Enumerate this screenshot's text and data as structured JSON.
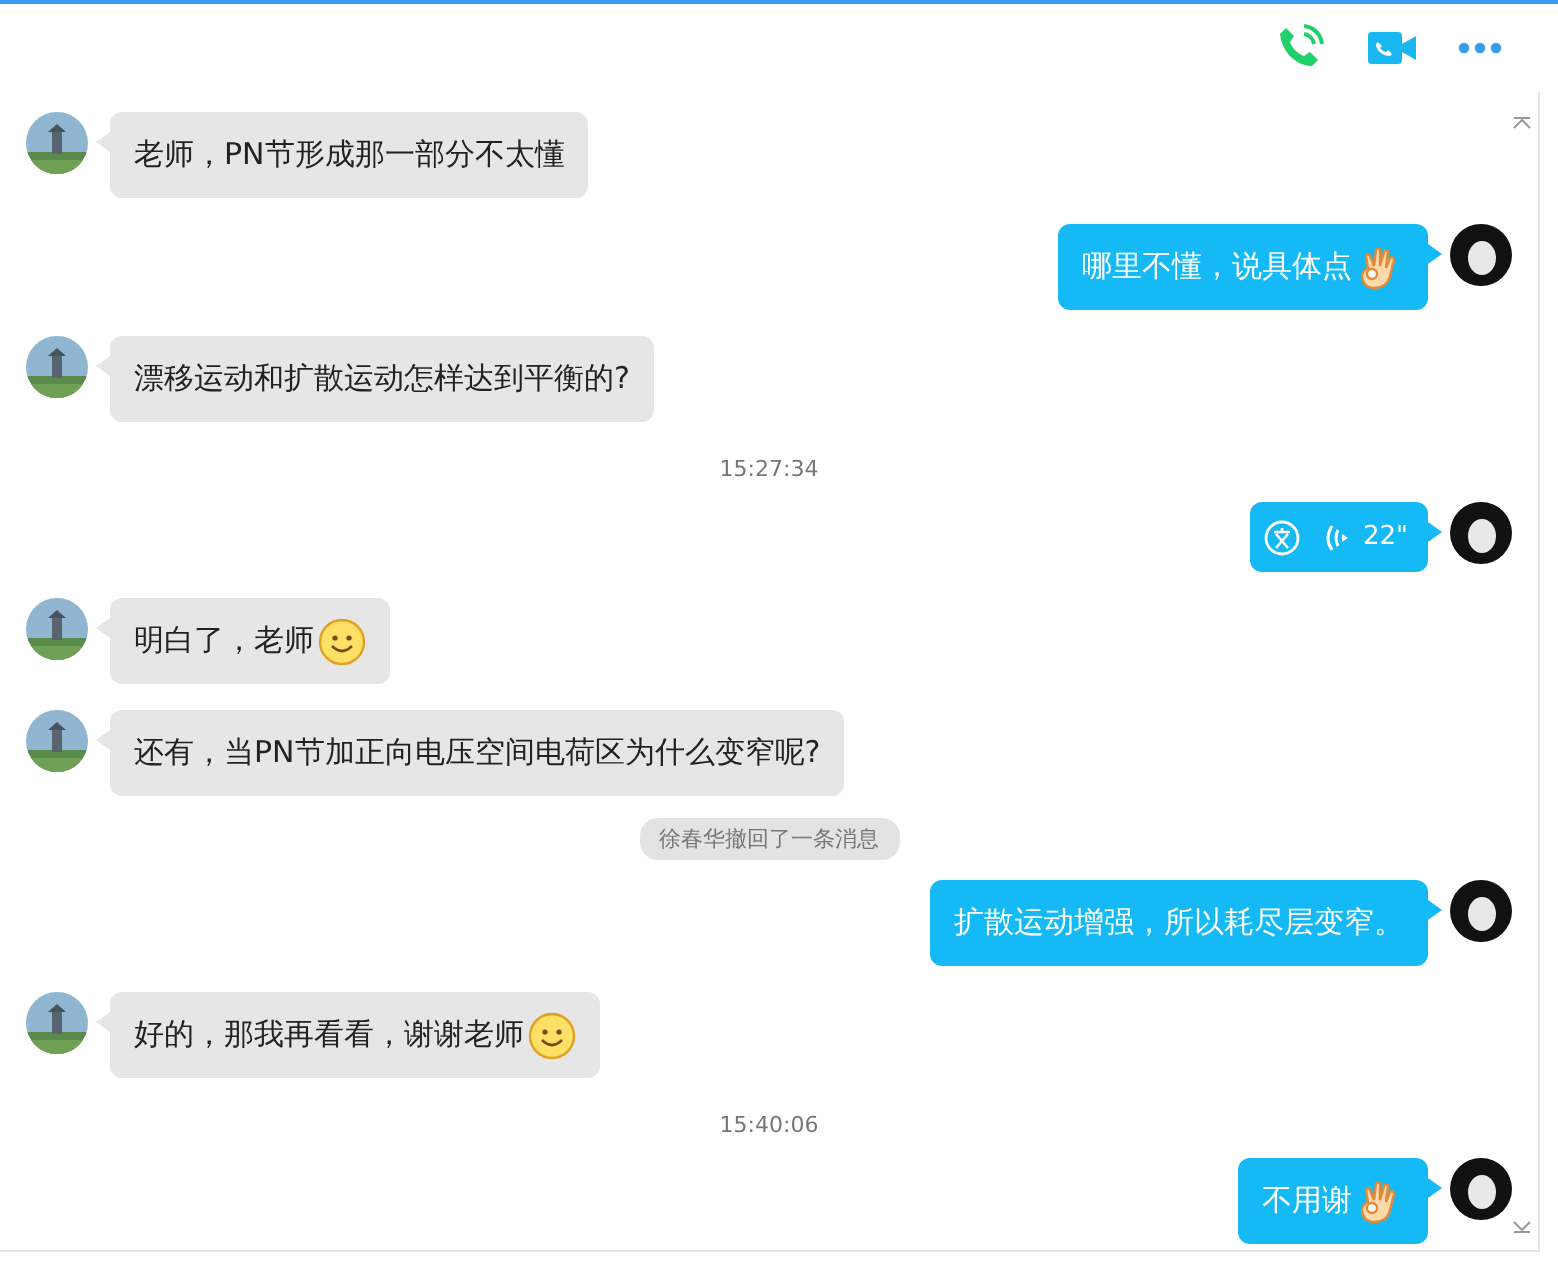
{
  "toolbar": {
    "actions": [
      {
        "kind": "call"
      },
      {
        "kind": "video"
      },
      {
        "kind": "more"
      }
    ]
  },
  "messages": [
    {
      "kind": "incoming",
      "text": "老师，PN节形成那一部分不太懂"
    },
    {
      "kind": "outgoing",
      "text": "哪里不懂，说具体点",
      "emoji": {
        "kind": "ok"
      }
    },
    {
      "kind": "incoming",
      "text": " 漂移运动和扩散运动怎样达到平衡的?"
    },
    {
      "kind": "time",
      "text": "15:27:34"
    },
    {
      "kind": "voice",
      "duration": "22\""
    },
    {
      "kind": "incoming",
      "text": "明白了，老师",
      "emoji": {
        "kind": "smile"
      }
    },
    {
      "kind": "incoming",
      "text": "还有，当PN节加正向电压空间电荷区为什么变窄呢?"
    },
    {
      "kind": "notice",
      "text": "徐春华撤回了一条消息"
    },
    {
      "kind": "outgoing",
      "text": "扩散运动增强，所以耗尽层变窄。"
    },
    {
      "kind": "incoming",
      "text": "好的，那我再看看，谢谢老师",
      "emoji": {
        "kind": "smile"
      }
    },
    {
      "kind": "time",
      "text": "15:40:06"
    },
    {
      "kind": "outgoing",
      "text": "不用谢",
      "emoji": {
        "kind": "ok"
      }
    }
  ]
}
